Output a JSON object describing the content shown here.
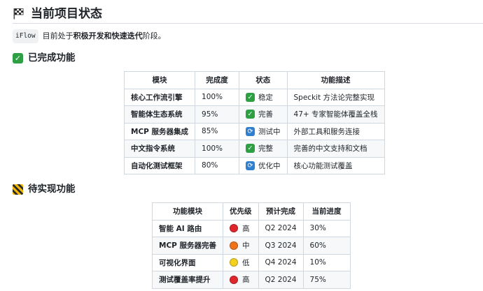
{
  "page_title": "当前项目状态",
  "intro": {
    "code": "iFlow",
    "text_before": "目前处于",
    "bold_text": "积极开发和快速迭代",
    "text_after": "阶段。"
  },
  "completed": {
    "heading": "已完成功能",
    "headers": [
      "模块",
      "完成度",
      "状态",
      "功能描述"
    ],
    "rows": [
      {
        "module": "核心工作流引擎",
        "progress": "100%",
        "status_icon": "check-icon",
        "status": "稳定",
        "desc": "Speckit 方法论完整实现"
      },
      {
        "module": "智能体生态系统",
        "progress": "95%",
        "status_icon": "check-icon",
        "status": "完善",
        "desc": "47+ 专家智能体覆盖全栈"
      },
      {
        "module": "MCP 服务器集成",
        "progress": "85%",
        "status_icon": "cycle-icon",
        "status": "测试中",
        "desc": "外部工具和服务连接"
      },
      {
        "module": "中文指令系统",
        "progress": "100%",
        "status_icon": "check-icon",
        "status": "完整",
        "desc": "完善的中文支持和文档"
      },
      {
        "module": "自动化测试框架",
        "progress": "80%",
        "status_icon": "cycle-icon",
        "status": "优化中",
        "desc": "核心功能测试覆盖"
      }
    ]
  },
  "pending": {
    "heading": "待实现功能",
    "headers": [
      "功能模块",
      "优先级",
      "预计完成",
      "当前进度"
    ],
    "rows": [
      {
        "module": "智能 AI 路由",
        "priority_color": "#e0262b",
        "priority": "高",
        "eta": "Q2 2024",
        "progress": "30%"
      },
      {
        "module": "MCP 服务器完善",
        "priority_color": "#f0731b",
        "priority": "中",
        "eta": "Q3 2024",
        "progress": "60%"
      },
      {
        "module": "可视化界面",
        "priority_color": "#f4d21c",
        "priority": "低",
        "eta": "Q4 2024",
        "progress": "10%"
      },
      {
        "module": "测试覆盖率提升",
        "priority_color": "#e0262b",
        "priority": "高",
        "eta": "Q2 2024",
        "progress": "75%"
      }
    ]
  },
  "colors": {
    "check": "#2ea043",
    "cycle": "#2f7fd1",
    "border": "#d0d7de",
    "stripe": "#f6f8fa"
  }
}
